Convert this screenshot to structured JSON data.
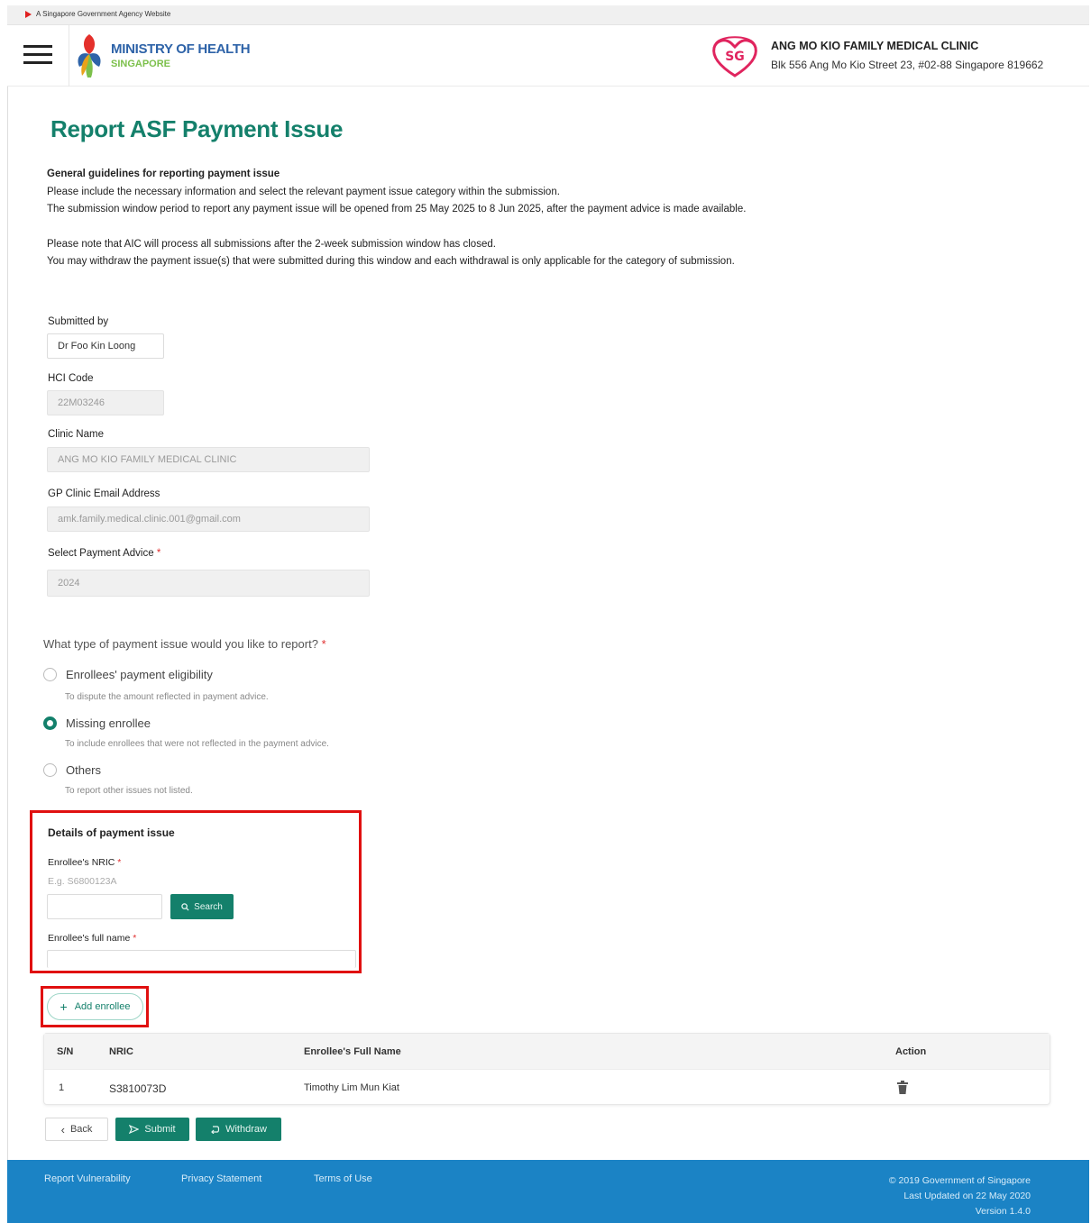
{
  "masthead": {
    "text": "A Singapore Government Agency Website"
  },
  "header": {
    "ministry_title": "MINISTRY OF HEALTH",
    "ministry_sub": "SINGAPORE",
    "clinic_name": "ANG MO KIO FAMILY MEDICAL CLINIC",
    "clinic_address": "Blk 556 Ang Mo Kio Street 23, #02-88 Singapore 819662"
  },
  "page": {
    "title": "Report ASF Payment Issue",
    "guidelines_heading": "General guidelines for reporting payment issue",
    "guideline_1": "Please include the necessary information and select the relevant payment issue category within the submission.",
    "guideline_2": "The submission window period to report any payment issue will be opened from 25 May 2025 to 8 Jun 2025, after the payment advice is made available.",
    "guideline_3": "Please note that AIC will process all submissions after the 2-week submission window has closed.",
    "guideline_4": "You may withdraw the payment issue(s) that were submitted during this window and each withdrawal is only applicable for the category of submission."
  },
  "form": {
    "submitted_by_label": "Submitted by",
    "submitted_by_value": "Dr Foo Kin Loong",
    "hci_label": "HCI Code",
    "hci_value": "22M03246",
    "clinic_label": "Clinic Name",
    "clinic_value": "ANG MO KIO FAMILY MEDICAL CLINIC",
    "email_label": "GP Clinic Email Address",
    "email_value": "amk.family.medical.clinic.001@gmail.com",
    "advice_label": "Select Payment Advice",
    "advice_value": "2024",
    "required_mark": "*"
  },
  "issue": {
    "question": "What type of payment issue would you like to report?",
    "options": [
      {
        "label": "Enrollees' payment eligibility",
        "hint": "To dispute the amount reflected in payment advice.",
        "selected": false
      },
      {
        "label": "Missing enrollee",
        "hint": "To include enrollees that were not reflected in the payment advice.",
        "selected": true
      },
      {
        "label": "Others",
        "hint": "To report other issues not listed.",
        "selected": false
      }
    ]
  },
  "details": {
    "title": "Details of payment issue",
    "nric_label": "Enrollee's NRIC",
    "nric_hint": "E.g. S6800123A",
    "search_label": "Search",
    "fullname_label": "Enrollee's full name",
    "add_label": "Add enrollee"
  },
  "table": {
    "headers": [
      "S/N",
      "NRIC",
      "Enrollee's Full Name",
      "Action"
    ],
    "rows": [
      {
        "sn": "1",
        "nric": "S3810073D",
        "name": "Timothy Lim Mun Kiat"
      }
    ]
  },
  "actions": {
    "back": "Back",
    "submit": "Submit",
    "withdraw": "Withdraw"
  },
  "footer": {
    "links": [
      "Report Vulnerability",
      "Privacy Statement",
      "Terms of Use"
    ],
    "copyright": "© 2019 Government of Singapore",
    "updated": "Last Updated on 22 May 2020",
    "version": "Version 1.4.0"
  },
  "colors": {
    "brand_green": "#14806b",
    "footer_blue": "#1b83c5",
    "highlight_red": "#e01010"
  }
}
